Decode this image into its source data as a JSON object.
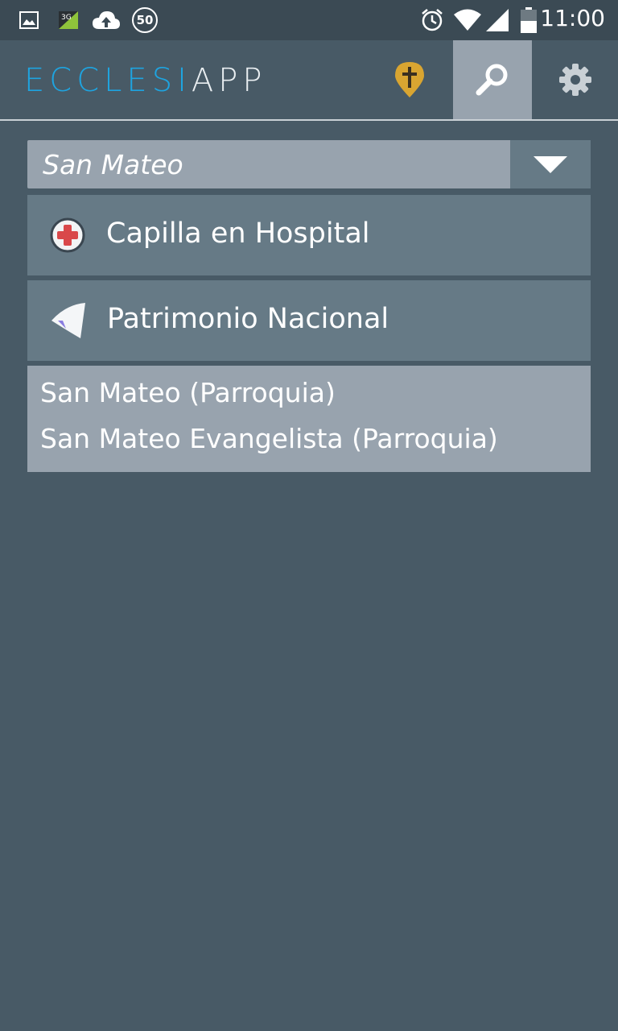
{
  "status_bar": {
    "time": "11:00",
    "notification_badge": "50",
    "network_label": "3G",
    "icons": [
      "image-icon",
      "3g-signal-icon",
      "cloud-upload-icon",
      "badge-50-icon",
      "alarm-icon",
      "wifi-icon",
      "cell-signal-icon",
      "battery-icon"
    ]
  },
  "app_bar": {
    "logo_part1": "ECCLESI",
    "logo_part2": "APP",
    "colors": {
      "logo_blue": "#1ea4e0",
      "pin_gold": "#d9a531",
      "active_tab": "#98a3ae"
    },
    "actions": [
      "map-pin-cross-icon",
      "search-icon",
      "gear-icon"
    ]
  },
  "search": {
    "selected_value": "San Mateo"
  },
  "filters": [
    {
      "label": "Capilla en Hospital",
      "icon": "hospital-cross-icon"
    },
    {
      "label": "Patrimonio Nacional",
      "icon": "heritage-flag-icon"
    }
  ],
  "results": [
    {
      "label": "San Mateo (Parroquia)"
    },
    {
      "label": "San Mateo Evangelista (Parroquia)"
    }
  ]
}
